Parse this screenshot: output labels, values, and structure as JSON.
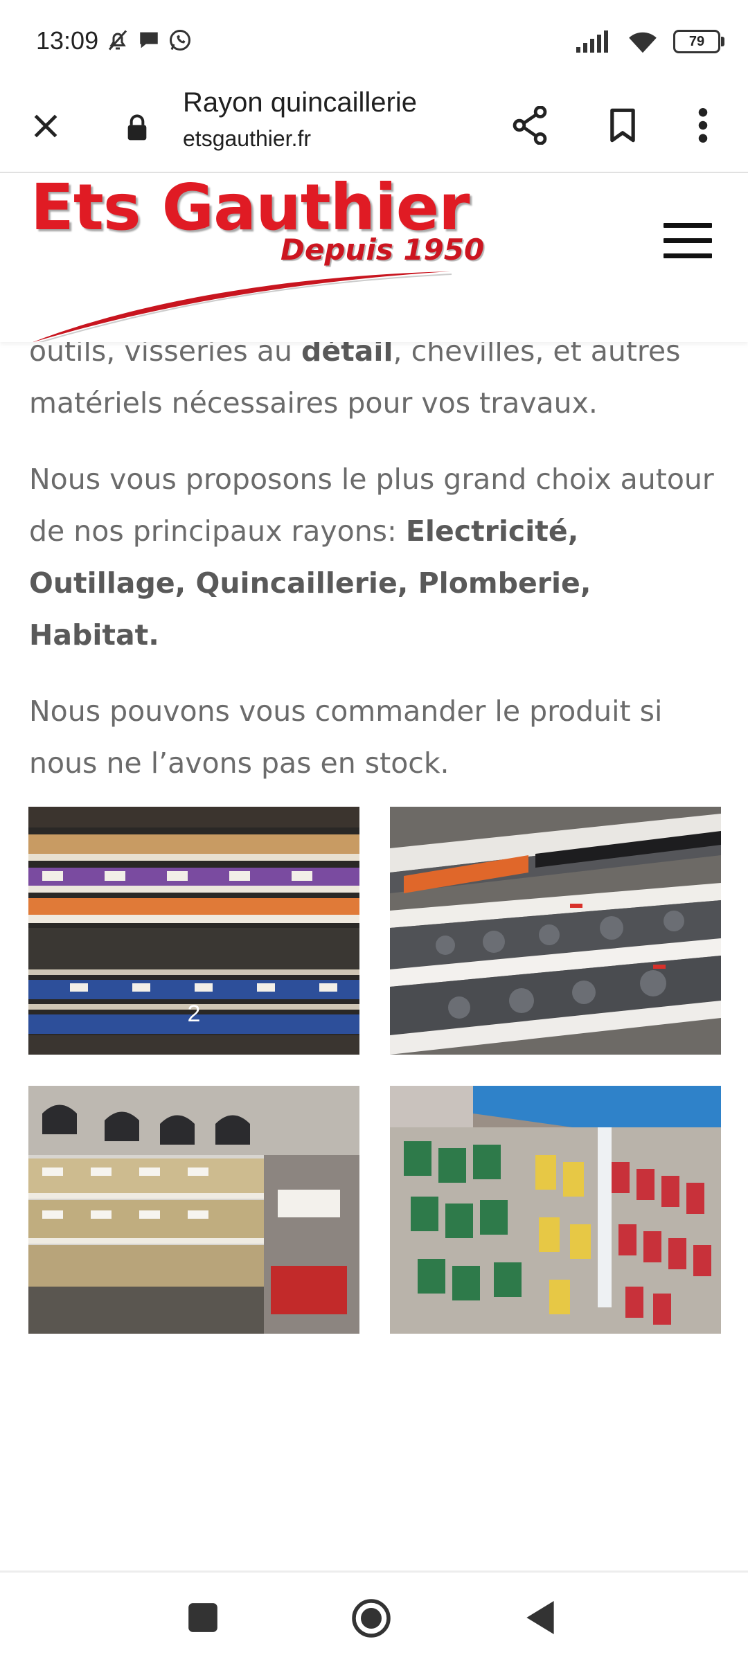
{
  "status_bar": {
    "time": "13:09",
    "battery": "79",
    "icons": [
      "bell-off-icon",
      "chat-bubble-icon",
      "whatsapp-icon",
      "signal-icon",
      "wifi-icon",
      "battery-icon"
    ]
  },
  "browser": {
    "page_title": "Rayon quincaillerie",
    "url": "etsgauthier.fr",
    "icons": [
      "close-icon",
      "lock-icon",
      "share-icon",
      "bookmark-icon",
      "more-vert-icon"
    ]
  },
  "site": {
    "logo_title": "Ets Gauthier",
    "logo_subtitle": "Depuis 1950",
    "brand_color": "#e01b24"
  },
  "content": {
    "p1_a": "outils, visseries au ",
    "p1_bold": "détail",
    "p1_b": ", chevilles, et autres matériels nécessaires pour vos travaux.",
    "p2_a": "Nous vous proposons le plus grand choix autour de nos principaux rayons: ",
    "p2_bold": "Electricité, Outillage, Quincaillerie, Plomberie, Habitat.",
    "p3": "Nous pouvons vous commander le produit si nous ne l’avons pas en stock."
  },
  "gallery": {
    "tile1_caption": "2",
    "images": [
      "hardware-shelves-photo",
      "pvc-fittings-photo",
      "hooks-shelves-photo",
      "fittings-wall-photo"
    ]
  },
  "nav": {
    "icons": [
      "recents-square-icon",
      "home-circle-icon",
      "back-triangle-icon"
    ]
  }
}
